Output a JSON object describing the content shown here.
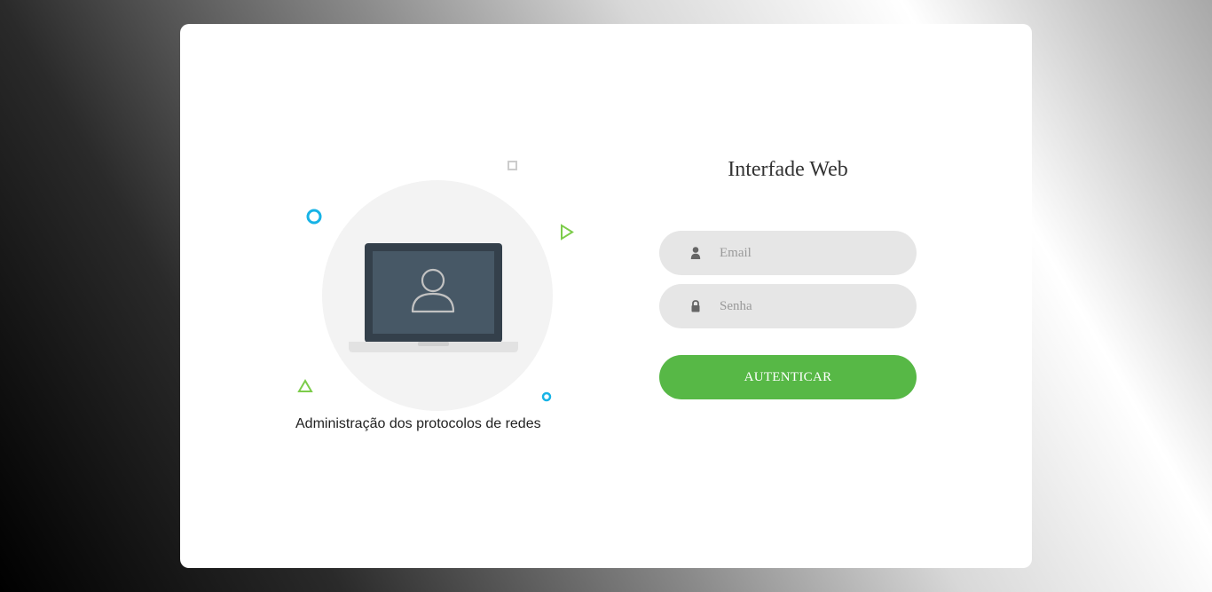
{
  "illustration": {
    "caption": "Administração dos protocolos de redes",
    "icon": "laptop-user-icon",
    "decorations": [
      "circle-icon",
      "square-icon",
      "triangle-right-icon",
      "triangle-up-icon",
      "small-circle-icon"
    ]
  },
  "login": {
    "title": "Interfade Web",
    "email_placeholder": "Email",
    "email_value": "",
    "password_placeholder": "Senha",
    "password_value": "",
    "submit_label": "AUTENTICAR"
  },
  "colors": {
    "accent": "#57b846",
    "card": "#ffffff",
    "field_bg": "#e6e6e6",
    "deco_blue": "#17b3e6",
    "deco_green": "#7ccc4a",
    "laptop_frame": "#34404b",
    "laptop_screen": "#475866"
  }
}
